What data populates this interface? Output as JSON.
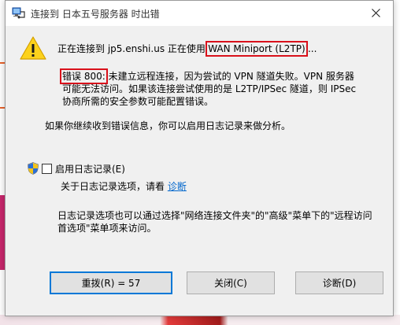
{
  "window": {
    "title": "连接到 日本五号服务器 时出错",
    "close_symbol": "close"
  },
  "message": {
    "line1_prefix": "正在连接到 jp5.enshi.us 正在使用'",
    "device": "WAN Miniport (L2TP)",
    "line1_suffix": "'...",
    "error_code": "错误 800:",
    "error_line1": " 未建立远程连接，因为尝试的 VPN 隧道失败。VPN 服务器",
    "error_line2": "可能无法访问。如果该连接尝试使用的是 L2TP/IPSec 隧道，则 IPSec",
    "error_line3": "协商所需的安全参数可能配置错误。",
    "continue_note": "如果你继续收到错误信息，你可以启用日志记录来做分析。"
  },
  "logging": {
    "checkbox_label": "启用日志记录(E)",
    "checked": false,
    "about_prefix": "关于日志记录选项，请看 ",
    "about_link": "诊断",
    "info_line1": "日志记录选项也可以通过选择\"网络连接文件夹\"的\"高级\"菜单下的\"远程访问",
    "info_line2": "首选项\"菜单项来访问。"
  },
  "buttons": {
    "redial": "重拨(R) = 57",
    "close": "关闭(C)",
    "diagnose": "诊断(D)"
  },
  "colors": {
    "highlight_box": "#d9111b",
    "link": "#0066cc",
    "default_button_border": "#0078d7",
    "dialog_bg": "#f0f0f0"
  },
  "icons": {
    "title": "network-connection-icon",
    "warning": "warning-triangle-icon",
    "shield": "uac-shield-icon"
  }
}
